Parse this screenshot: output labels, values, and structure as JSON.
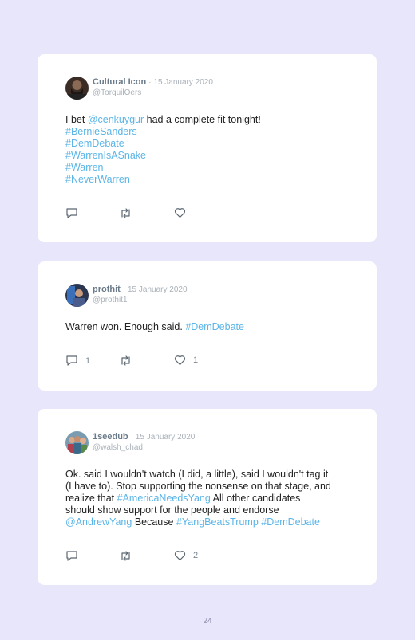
{
  "tweets": [
    {
      "name": "Cultural Icon",
      "date": "· 15 January 2020",
      "handle": "@TorquilOers",
      "avatar": "dark-beard-avatar",
      "text": {
        "prefix": "I bet ",
        "mention": "@cenkuygur",
        "suffix": " had a complete fit tonight!",
        "hashtags": [
          "#BernieSanders",
          "#DemDebate",
          "#WarrenIsASnake",
          "#Warren",
          "#NeverWarren"
        ]
      },
      "reply_count": "",
      "like_count": ""
    },
    {
      "name": "prothit",
      "date": "· 15 January 2020",
      "handle": "@prothit1",
      "avatar": "blue-portrait-avatar",
      "text": {
        "prefix": "Warren won. Enough said. ",
        "hashtag": "#DemDebate"
      },
      "reply_count": "1",
      "like_count": "1"
    },
    {
      "name": "1seedub",
      "date": "· 15 January 2020",
      "handle": "@walsh_chad",
      "avatar": "group-photo-avatar",
      "text": {
        "line1": "Ok. said I wouldn't watch (I did, a little), said I wouldn't tag it",
        "line2": "(I have to). Stop supporting the nonsense on that stage, and",
        "line3_prefix": "realize that ",
        "line3_tag": "#AmericaNeedsYang",
        "line3_suffix": " All other candidates",
        "line4": "should show support for the people and endorse",
        "line5_mention": "@AndrewYang",
        "line5_mid": " Because ",
        "line5_tag1": "#YangBeatsTrump",
        "line5_space": " ",
        "line5_tag2": "#DemDebate"
      },
      "reply_count": "",
      "like_count": "2"
    }
  ],
  "icons": {
    "reply": "speech-bubble-icon",
    "retweet": "retweet-icon",
    "like": "heart-icon"
  },
  "colors": {
    "background": "#e8e6fb",
    "link": "#5bb5e8",
    "name": "#6a7a89",
    "meta": "#a9b1b9"
  },
  "page_number": "24"
}
